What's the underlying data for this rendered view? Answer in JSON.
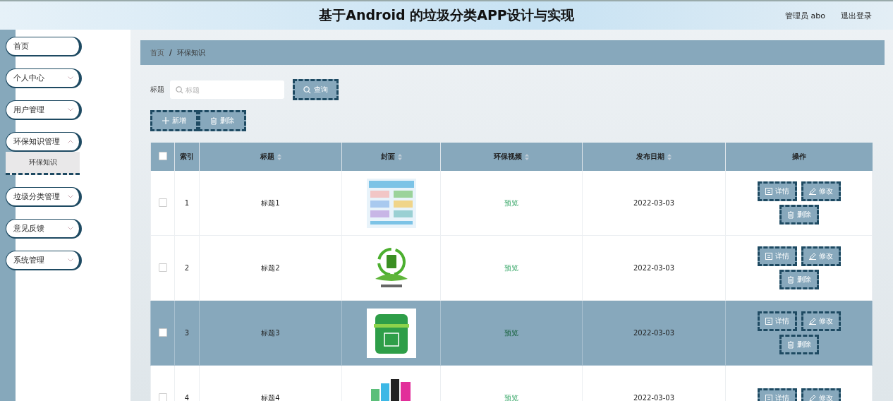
{
  "header": {
    "title": "基于Android 的垃圾分类APP设计与实现",
    "user": "管理员 abo",
    "logout": "退出登录"
  },
  "sidebar": {
    "items": [
      {
        "kind": "link",
        "label": "首页"
      },
      {
        "kind": "submenu",
        "label": "个人中心",
        "expanded": false
      },
      {
        "kind": "submenu",
        "label": "用户管理",
        "expanded": false
      },
      {
        "kind": "submenu",
        "label": "环保知识管理",
        "expanded": true,
        "children": [
          {
            "label": "环保知识",
            "selected": true
          }
        ]
      },
      {
        "kind": "submenu",
        "label": "垃圾分类管理",
        "expanded": false
      },
      {
        "kind": "submenu",
        "label": "意见反馈",
        "expanded": false
      },
      {
        "kind": "submenu",
        "label": "系统管理",
        "expanded": false
      }
    ]
  },
  "breadcrumb": {
    "items": [
      "首页",
      "环保知识"
    ],
    "separator": "/"
  },
  "search": {
    "label": "标题",
    "placeholder": "标题",
    "button": "查询"
  },
  "toolbar": [
    {
      "kind": "add",
      "label": "新增"
    },
    {
      "kind": "delete",
      "label": "删除"
    }
  ],
  "table": {
    "all_checked": false,
    "columns": [
      {
        "label": "索引",
        "sortable": false
      },
      {
        "label": "标题",
        "sortable": true
      },
      {
        "label": "封面",
        "sortable": true
      },
      {
        "label": "环保视频",
        "sortable": true
      },
      {
        "label": "发布日期",
        "sortable": true
      },
      {
        "label": "操作",
        "sortable": false
      }
    ],
    "rows": [
      {
        "selected": false,
        "checked": false,
        "index": "1",
        "title": "标题1",
        "video": "预览",
        "date": "2022-03-03",
        "actions": [
          {
            "kind": "detail",
            "label": "详情"
          },
          {
            "kind": "edit",
            "label": "修改"
          },
          {
            "kind": "delete",
            "label": "删除"
          }
        ]
      },
      {
        "selected": false,
        "checked": false,
        "index": "2",
        "title": "标题2",
        "video": "预览",
        "date": "2022-03-03",
        "actions": [
          {
            "kind": "detail",
            "label": "详情"
          },
          {
            "kind": "edit",
            "label": "修改"
          },
          {
            "kind": "delete",
            "label": "删除"
          }
        ]
      },
      {
        "selected": true,
        "checked": false,
        "index": "3",
        "title": "标题3",
        "video": "预览",
        "date": "2022-03-03",
        "actions": [
          {
            "kind": "detail",
            "label": "详情"
          },
          {
            "kind": "edit",
            "label": "修改"
          },
          {
            "kind": "delete",
            "label": "删除"
          }
        ]
      },
      {
        "selected": false,
        "checked": false,
        "index": "4",
        "title": "标题4",
        "video": "预览",
        "date": "2022-03-03",
        "actions": [
          {
            "kind": "detail",
            "label": "详情"
          },
          {
            "kind": "edit",
            "label": "修改"
          }
        ]
      }
    ]
  }
}
